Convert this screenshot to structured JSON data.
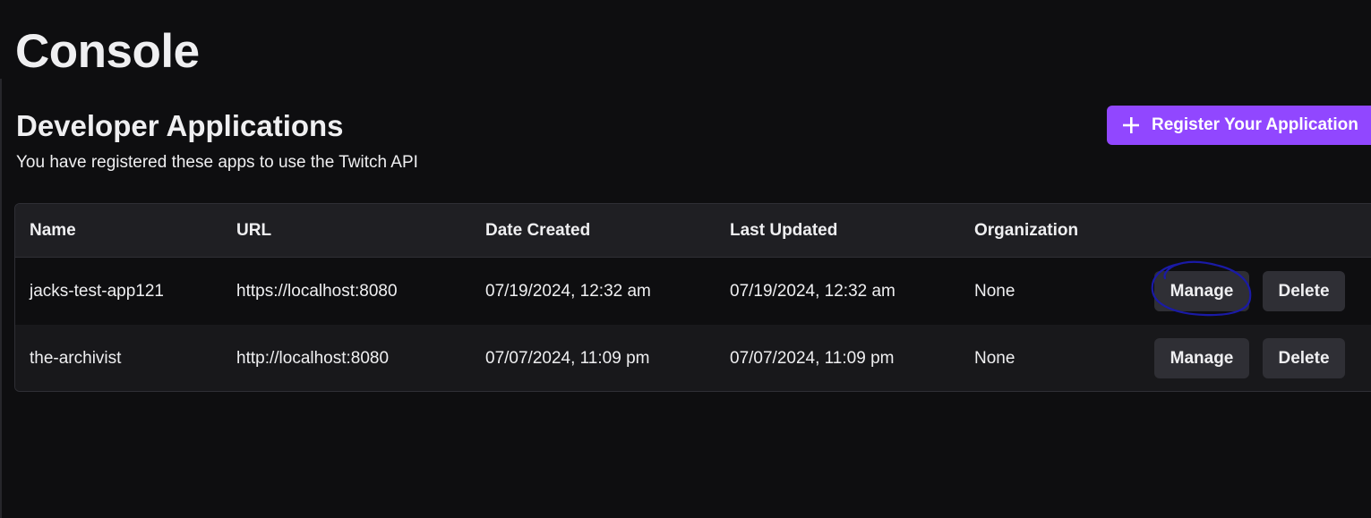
{
  "page": {
    "title": "Console",
    "section_title": "Developer Applications",
    "section_subtitle": "You have registered these apps to use the Twitch API",
    "register_button_label": "Register Your Application",
    "register_button_icon": "plus-icon"
  },
  "colors": {
    "background": "#0e0e10",
    "accent": "#9147ff",
    "secondary_button": "#2f2f35",
    "annotation_ink": "#1a1aa6"
  },
  "table": {
    "columns": [
      "Name",
      "URL",
      "Date Created",
      "Last Updated",
      "Organization"
    ],
    "rows": [
      {
        "name": "jacks-test-app121",
        "url": "https://localhost:8080",
        "date_created": "07/19/2024, 12:32 am",
        "last_updated": "07/19/2024, 12:32 am",
        "organization": "None",
        "manage_label": "Manage",
        "delete_label": "Delete"
      },
      {
        "name": "the-archivist",
        "url": "http://localhost:8080",
        "date_created": "07/07/2024, 11:09 pm",
        "last_updated": "07/07/2024, 11:09 pm",
        "organization": "None",
        "manage_label": "Manage",
        "delete_label": "Delete"
      }
    ]
  }
}
